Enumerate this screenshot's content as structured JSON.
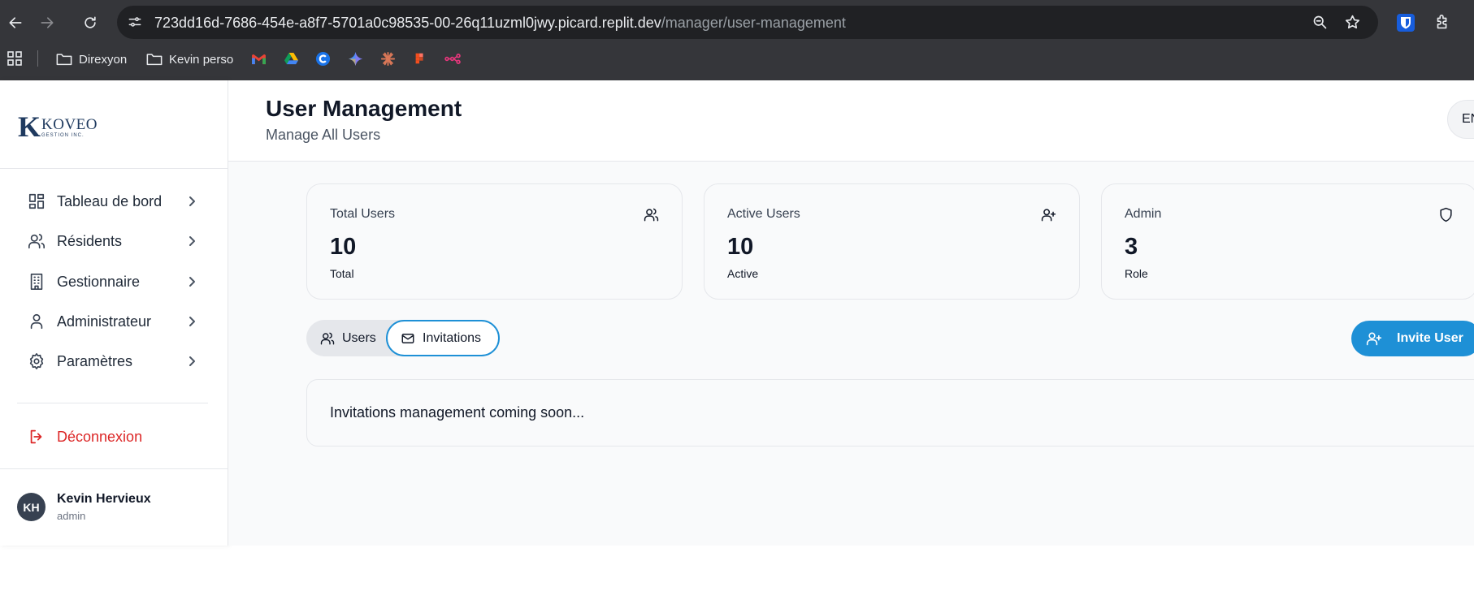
{
  "browser": {
    "url_host": "723dd16d-7686-454e-a8f7-5701a0c98535-00-26q11uzml0jwy.picard.replit.dev",
    "url_path": "/manager/user-management",
    "bookmarks": [
      {
        "label": "Direxyon",
        "icon": "folder-icon"
      },
      {
        "label": "Kevin perso",
        "icon": "folder-icon"
      }
    ],
    "favicons": [
      "gmail-icon",
      "google-drive-icon",
      "coda-icon",
      "gemini-icon",
      "claude-icon",
      "figma-icon",
      "workflow-icon"
    ]
  },
  "logo": {
    "letter": "K",
    "name": "KOVEO",
    "sub": "GESTION INC."
  },
  "sidebar": {
    "items": [
      {
        "label": "Tableau de bord",
        "icon": "dashboard-icon"
      },
      {
        "label": "Résidents",
        "icon": "users-icon"
      },
      {
        "label": "Gestionnaire",
        "icon": "building-icon"
      },
      {
        "label": "Administrateur",
        "icon": "user-icon"
      },
      {
        "label": "Paramètres",
        "icon": "gear-icon"
      }
    ],
    "logout_label": "Déconnexion",
    "user": {
      "initials": "KH",
      "name": "Kevin Hervieux",
      "role": "admin"
    }
  },
  "header": {
    "title": "User Management",
    "subtitle": "Manage All Users",
    "language_button": "EN"
  },
  "stats": [
    {
      "label": "Total Users",
      "value": "10",
      "caption": "Total",
      "icon": "users-icon"
    },
    {
      "label": "Active Users",
      "value": "10",
      "caption": "Active",
      "icon": "user-plus-icon"
    },
    {
      "label": "Admin",
      "value": "3",
      "caption": "Role",
      "icon": "shield-icon"
    }
  ],
  "tabs": {
    "users_label": "Users",
    "invitations_label": "Invitations",
    "active": "Invitations"
  },
  "invite_button": "Invite User",
  "panel": {
    "message": "Invitations management coming soon..."
  },
  "colors": {
    "accent": "#1e90d6",
    "danger": "#dc2626",
    "chrome": "#35363a"
  }
}
